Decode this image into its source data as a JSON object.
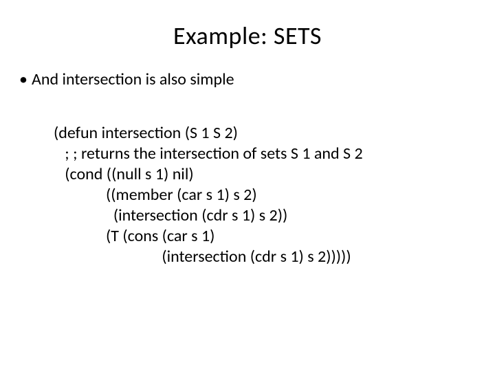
{
  "slide": {
    "title": "Example: SETS",
    "bullet": {
      "dot": "•",
      "text": "And intersection is also simple"
    },
    "code": {
      "l1": "(defun intersection (S 1 S 2)",
      "l2": "   ; ; returns the intersection of sets S 1 and S 2",
      "l3": "   (cond ((null s 1) nil)",
      "l4": "              ((member (car s 1) s 2)",
      "l5": "                (intersection (cdr s 1) s 2))",
      "l6": "              (T (cons (car s 1)",
      "l7": "                             (intersection (cdr s 1) s 2)))))"
    }
  }
}
